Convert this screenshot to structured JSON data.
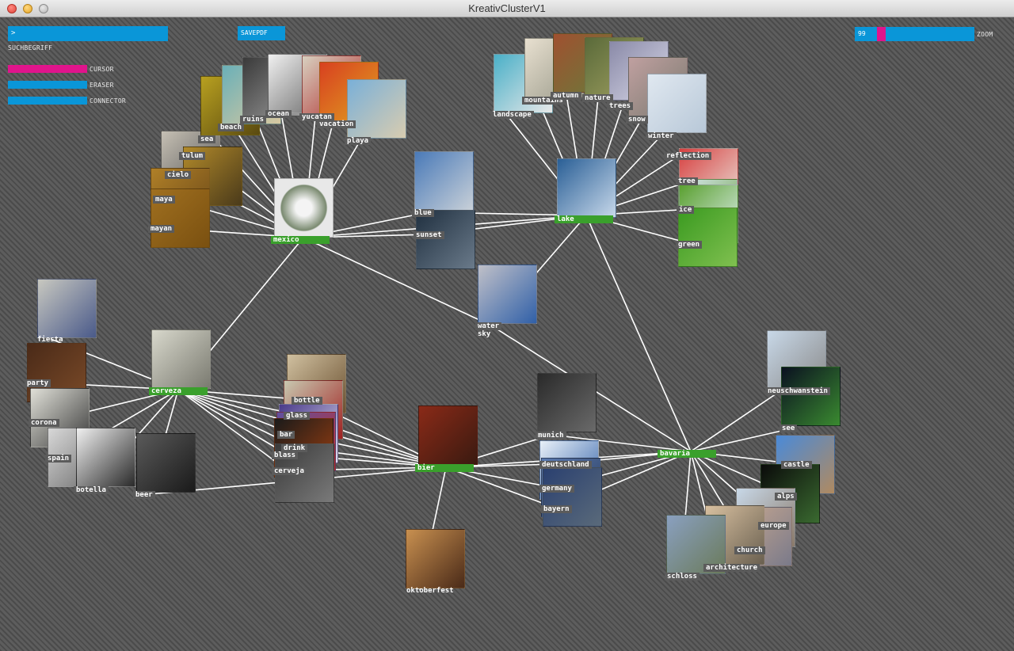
{
  "window": {
    "title": "KreativClusterV1"
  },
  "controls": {
    "search": {
      "value": ">",
      "label": "SUCHBEGRIFF"
    },
    "savepdf_label": "SAVEPDF",
    "zoom": {
      "value": "99",
      "label": "ZOOM"
    },
    "tools": [
      {
        "label": "CURSOR",
        "color": "#e0148c"
      },
      {
        "label": "ERASER",
        "color": "#0a96d8"
      },
      {
        "label": "CONNECTOR",
        "color": "#0a96d8"
      }
    ]
  },
  "colors": {
    "hub": "#3aa02c",
    "link": "#ffffff",
    "tool_blue": "#0a96d8",
    "tool_pink": "#e0148c"
  },
  "hubs": [
    "mexico",
    "lake",
    "bier",
    "bavaria",
    "cerveza"
  ],
  "nodes": [
    "tulum",
    "cielo",
    "maya",
    "mayan",
    "sea",
    "beach",
    "ruins",
    "ocean",
    "yucatan",
    "vacation",
    "playa",
    "blue",
    "sunset",
    "landscape",
    "mountains",
    "autumn",
    "nature",
    "trees",
    "snow",
    "winter",
    "reflection",
    "tree",
    "ice",
    "green",
    "water",
    "sky",
    "fiesta",
    "party",
    "corona",
    "spain",
    "botella",
    "beer",
    "bottle",
    "glass",
    "bar",
    "drink",
    "blass",
    "cerveja",
    "oktoberfest",
    "munich",
    "deutschland",
    "germany",
    "bayern",
    "neuschwanstein",
    "see",
    "castle",
    "alps",
    "europe",
    "church",
    "architecture",
    "schloss"
  ]
}
